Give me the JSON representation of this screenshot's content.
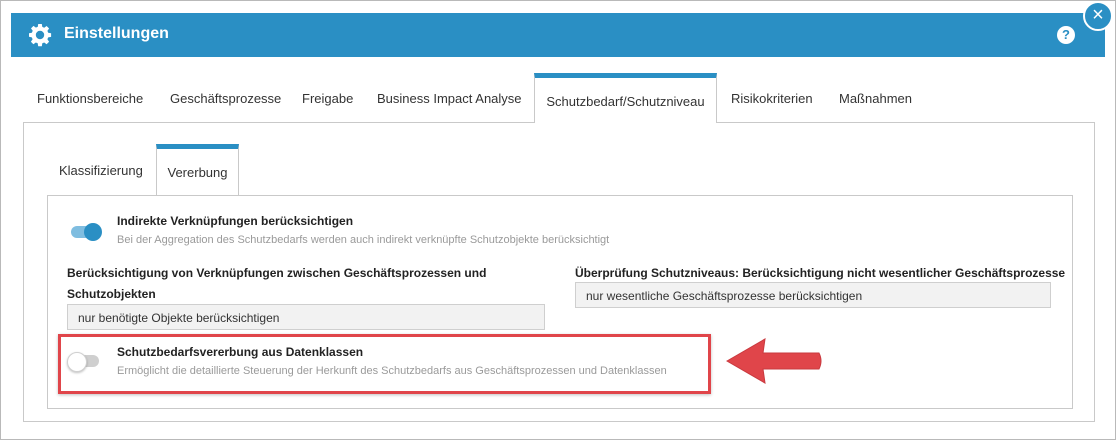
{
  "window": {
    "title": "Einstellungen",
    "help_label": "?",
    "close_label": "×",
    "accent_color": "#2a8fc4"
  },
  "outer_tabs": [
    {
      "label": "Funktionsbereiche",
      "active": false
    },
    {
      "label": "Geschäftsprozesse",
      "active": false
    },
    {
      "label": "Freigabe",
      "active": false
    },
    {
      "label": "Business Impact Analyse",
      "active": false
    },
    {
      "label": "Schutzbedarf/Schutzniveau",
      "active": true
    },
    {
      "label": "Risikokriterien",
      "active": false
    },
    {
      "label": "Maßnahmen",
      "active": false
    }
  ],
  "inner_tabs": [
    {
      "label": "Klassifizierung",
      "active": false
    },
    {
      "label": "Vererbung",
      "active": true
    }
  ],
  "settings": {
    "indirect": {
      "title": "Indirekte Verknüpfungen berücksichtigen",
      "description": "Bei der Aggregation des Schutzbedarfs werden auch indirekt verknüpfte Schutzobjekte berücksichtigt",
      "enabled": true
    },
    "links_field": {
      "label": "Berücksichtigung von Verknüpfungen zwischen Geschäftsprozessen und Schutzobjekten",
      "value": "nur benötigte Objekte berücksichtigen"
    },
    "check_field": {
      "label": "Überprüfung Schutzniveaus: Berücksichtigung nicht wesentlicher Geschäftsprozesse",
      "value": "nur wesentliche Geschäftsprozesse berücksichtigen"
    },
    "data_classes": {
      "title": "Schutzbedarfsvererbung aus Datenklassen",
      "description": "Ermöglicht die detaillierte Steuerung der Herkunft des Schutzbedarfs aus Geschäftsprozessen und Datenklassen",
      "enabled": false
    }
  },
  "annotation": {
    "highlight_color": "#e0454a",
    "arrow_icon": "arrow-left-icon"
  }
}
